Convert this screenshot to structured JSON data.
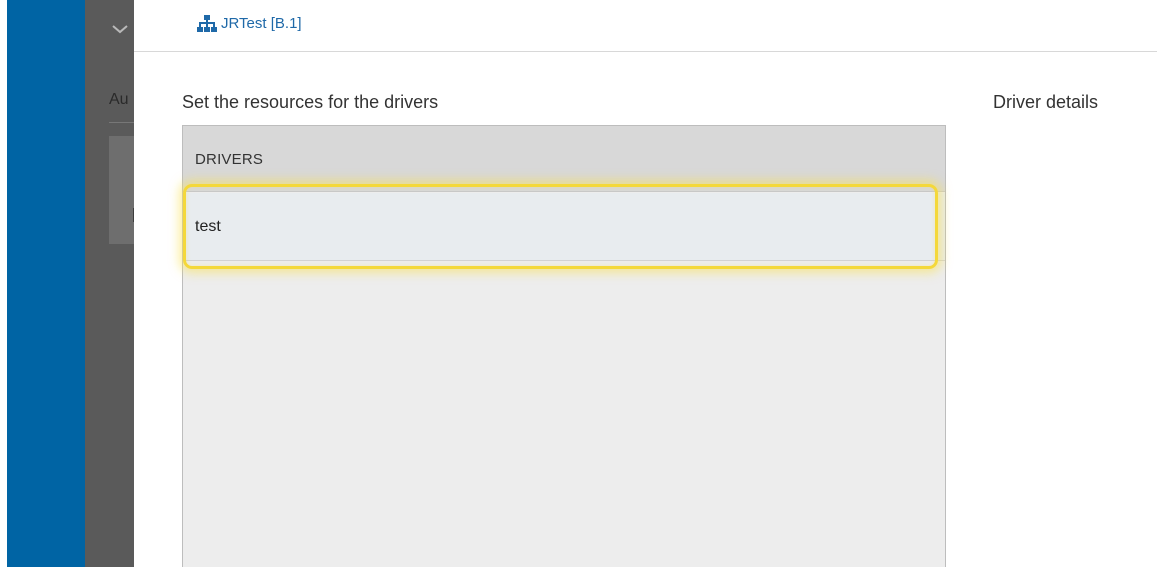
{
  "background_panel": {
    "label_fragment": "Au"
  },
  "header": {
    "breadcrumb": "JRTest [B.1]"
  },
  "main": {
    "section_title": "Set the resources for the drivers",
    "details_title": "Driver details",
    "table": {
      "column_header": "DRIVERS",
      "rows": [
        {
          "name": "test"
        }
      ]
    }
  },
  "colors": {
    "sidebar_blue": "#0064a4",
    "link_blue": "#1f69a8",
    "highlight_yellow": "#f4d83a"
  },
  "icons": {
    "breadcrumb": "hierarchy-icon",
    "collapse": "chevron-down-icon"
  }
}
